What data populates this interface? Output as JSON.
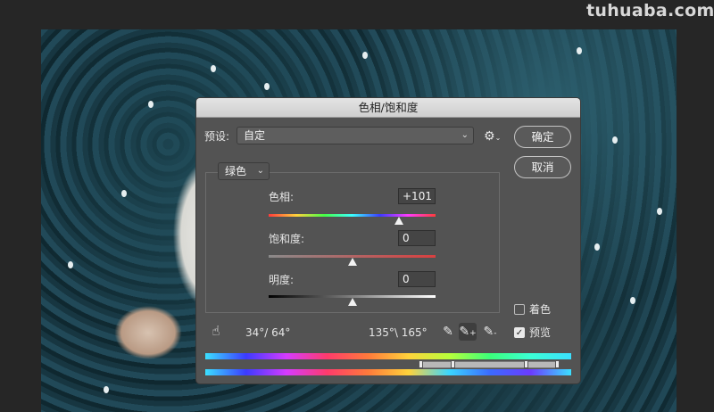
{
  "watermark": "tuhuaba.com",
  "dialog": {
    "title": "色相/饱和度",
    "preset_label": "预设:",
    "preset_value": "自定",
    "ok_label": "确定",
    "cancel_label": "取消",
    "channel_value": "绿色",
    "hue": {
      "label": "色相:",
      "value": "+101",
      "level": 0.78
    },
    "saturation": {
      "label": "饱和度:",
      "value": "0",
      "level": 0.5
    },
    "lightness": {
      "label": "明度:",
      "value": "0",
      "level": 0.5
    },
    "colorize_label": "着色",
    "preview_label": "预览",
    "colorize_checked": false,
    "preview_checked": true,
    "range_left": "34°/ 64°",
    "range_right": "135°\\ 165°",
    "icons": [
      "gear-icon",
      "hand-adjust-icon",
      "eyedropper-icon",
      "eyedropper-plus-icon",
      "eyedropper-minus-icon"
    ]
  },
  "colors": {
    "dialog_bg": "#535353",
    "titlebar": "#d8d8d8"
  }
}
